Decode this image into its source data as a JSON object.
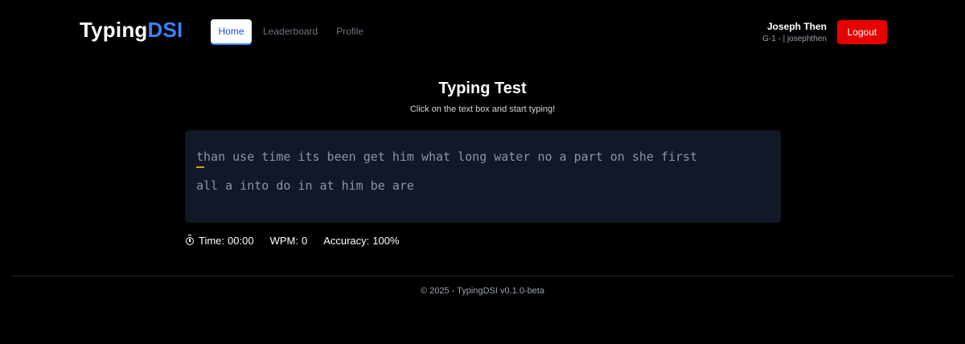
{
  "header": {
    "logo_part1": "Typing",
    "logo_part2": "DSI",
    "nav": {
      "home": "Home",
      "leaderboard": "Leaderboard",
      "profile": "Profile"
    },
    "user": {
      "name": "Joseph Then",
      "meta": "G-1 - | josephthen"
    },
    "logout_label": "Logout"
  },
  "colors": {
    "background": "#000000",
    "logo_accent": "#3b82f6",
    "logout": "#e60000",
    "text_box": "#111827",
    "cursor": "#d4a017"
  },
  "main": {
    "title": "Typing Test",
    "subtitle": "Click on the text box and start typing!",
    "typing_text_line1": "than use time its been get him what long water no a part on she first",
    "typing_text_line2": "all a into do in at him be are"
  },
  "stats": {
    "time_label": "Time:",
    "time_value": "00:00",
    "wpm_label": "WPM:",
    "wpm_value": "0",
    "accuracy_label": "Accuracy:",
    "accuracy_value": "100%",
    "timer_icon": "stopwatch-icon"
  },
  "footer": {
    "text": "© 2025 - TypingDSI v0.1.0-beta"
  }
}
